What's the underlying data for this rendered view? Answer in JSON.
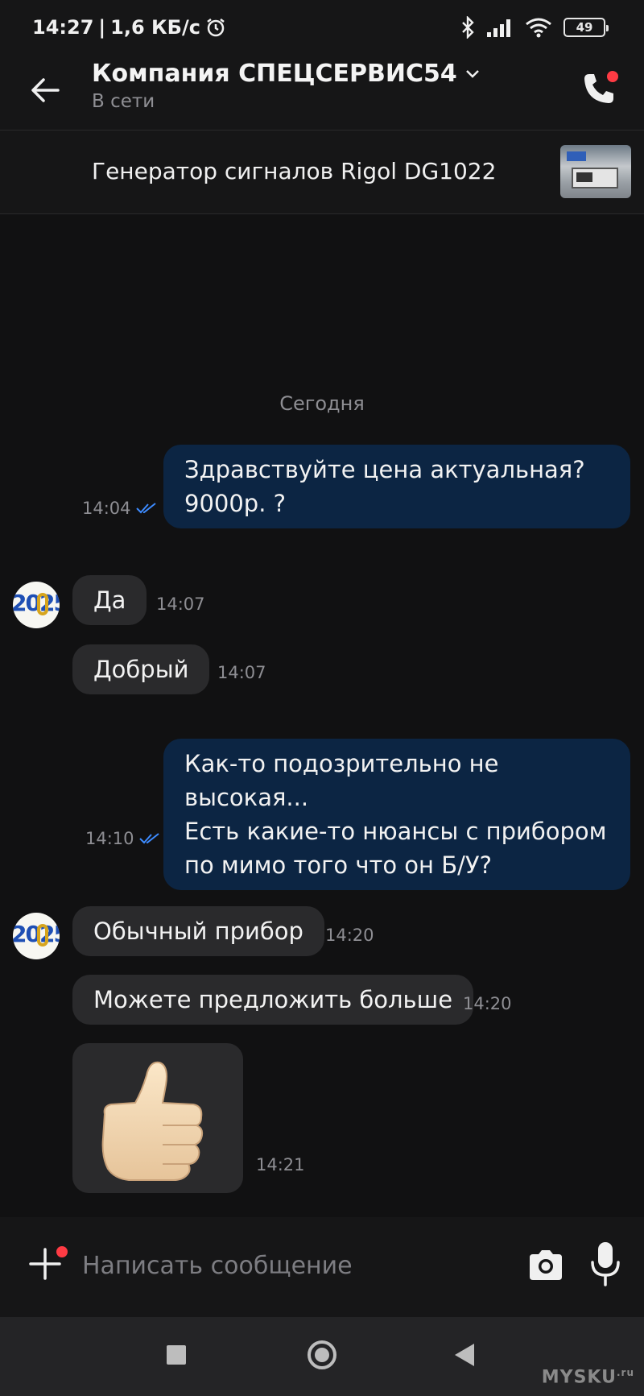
{
  "status_bar": {
    "time": "14:27",
    "separator": "|",
    "speed": "1,6 КБ/с",
    "battery": "49"
  },
  "header": {
    "title": "Компания СПЕЦСЕРВИС54",
    "status": "В сети"
  },
  "product": {
    "title": "Генератор сигналов Rigol DG1022"
  },
  "chat": {
    "date_separator": "Сегодня",
    "messages": [
      {
        "direction": "out",
        "lines": [
          "Здравствуйте цена актуальная?",
          "9000р. ?"
        ],
        "time": "14:04",
        "read": true
      },
      {
        "direction": "in",
        "text": "Да",
        "time": "14:07"
      },
      {
        "direction": "in",
        "text": "Добрый",
        "time": "14:07"
      },
      {
        "direction": "out",
        "lines": [
          "Как-то подозрительно не высокая...",
          "Есть какие-то нюансы с прибором",
          "по мимо того что он Б/У?"
        ],
        "time": "14:10",
        "read": true
      },
      {
        "direction": "in",
        "text": "Обычный прибор",
        "time": "14:20"
      },
      {
        "direction": "in",
        "text": "Можете предложить больше",
        "time": "14:20"
      },
      {
        "direction": "in",
        "sticker": "thumbs-up",
        "time": "14:21"
      }
    ]
  },
  "input": {
    "placeholder": "Написать сообщение"
  },
  "watermark": {
    "text": "MYSKU",
    "suffix": ".ru"
  },
  "colors": {
    "background": "#111112",
    "outgoing_bubble": "#0c2543",
    "incoming_bubble": "#2a2a2c",
    "read_check": "#3d8bff",
    "notification_dot": "#ff3b44"
  }
}
